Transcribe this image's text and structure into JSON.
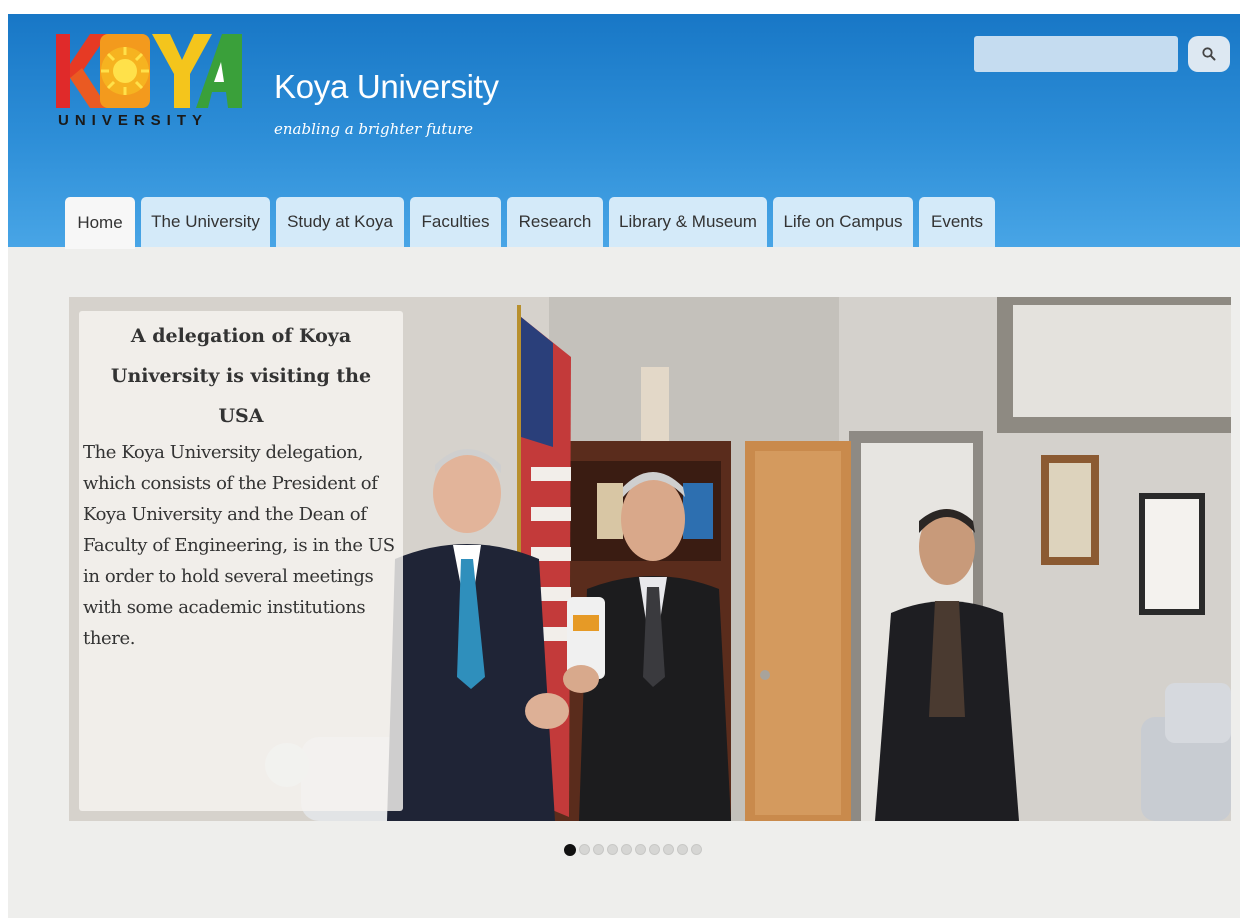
{
  "header": {
    "logo_word": "UNIVERSITY",
    "site_title": "Koya University",
    "tagline": "enabling a brighter future",
    "search_placeholder": "",
    "search_icon": "magnifier-icon"
  },
  "nav": {
    "tabs": [
      {
        "label": "Home",
        "active": true
      },
      {
        "label": "The University",
        "active": false
      },
      {
        "label": "Study at Koya",
        "active": false
      },
      {
        "label": "Faculties",
        "active": false
      },
      {
        "label": "Research",
        "active": false
      },
      {
        "label": "Library & Museum",
        "active": false
      },
      {
        "label": "Life on Campus",
        "active": false
      },
      {
        "label": "Events",
        "active": false
      }
    ]
  },
  "slider": {
    "caption_title": "A delegation of Koya University is visiting the USA",
    "caption_body": "The Koya University delegation, which consists of the President of Koya University and the Dean of Faculty of Engineering, is in the US in order to hold several meetings with some academic institutions there.",
    "slide_count": 10,
    "active_slide": 1
  },
  "colors": {
    "header_top": "#1877c6",
    "header_bottom": "#48a5e6",
    "tab_bg": "#d4eaf9",
    "page_bg": "#eeeeec",
    "logo_red": "#e02a2a",
    "logo_orange": "#f39a1d",
    "logo_yellow": "#f4c51c",
    "logo_green": "#3aa03a"
  }
}
